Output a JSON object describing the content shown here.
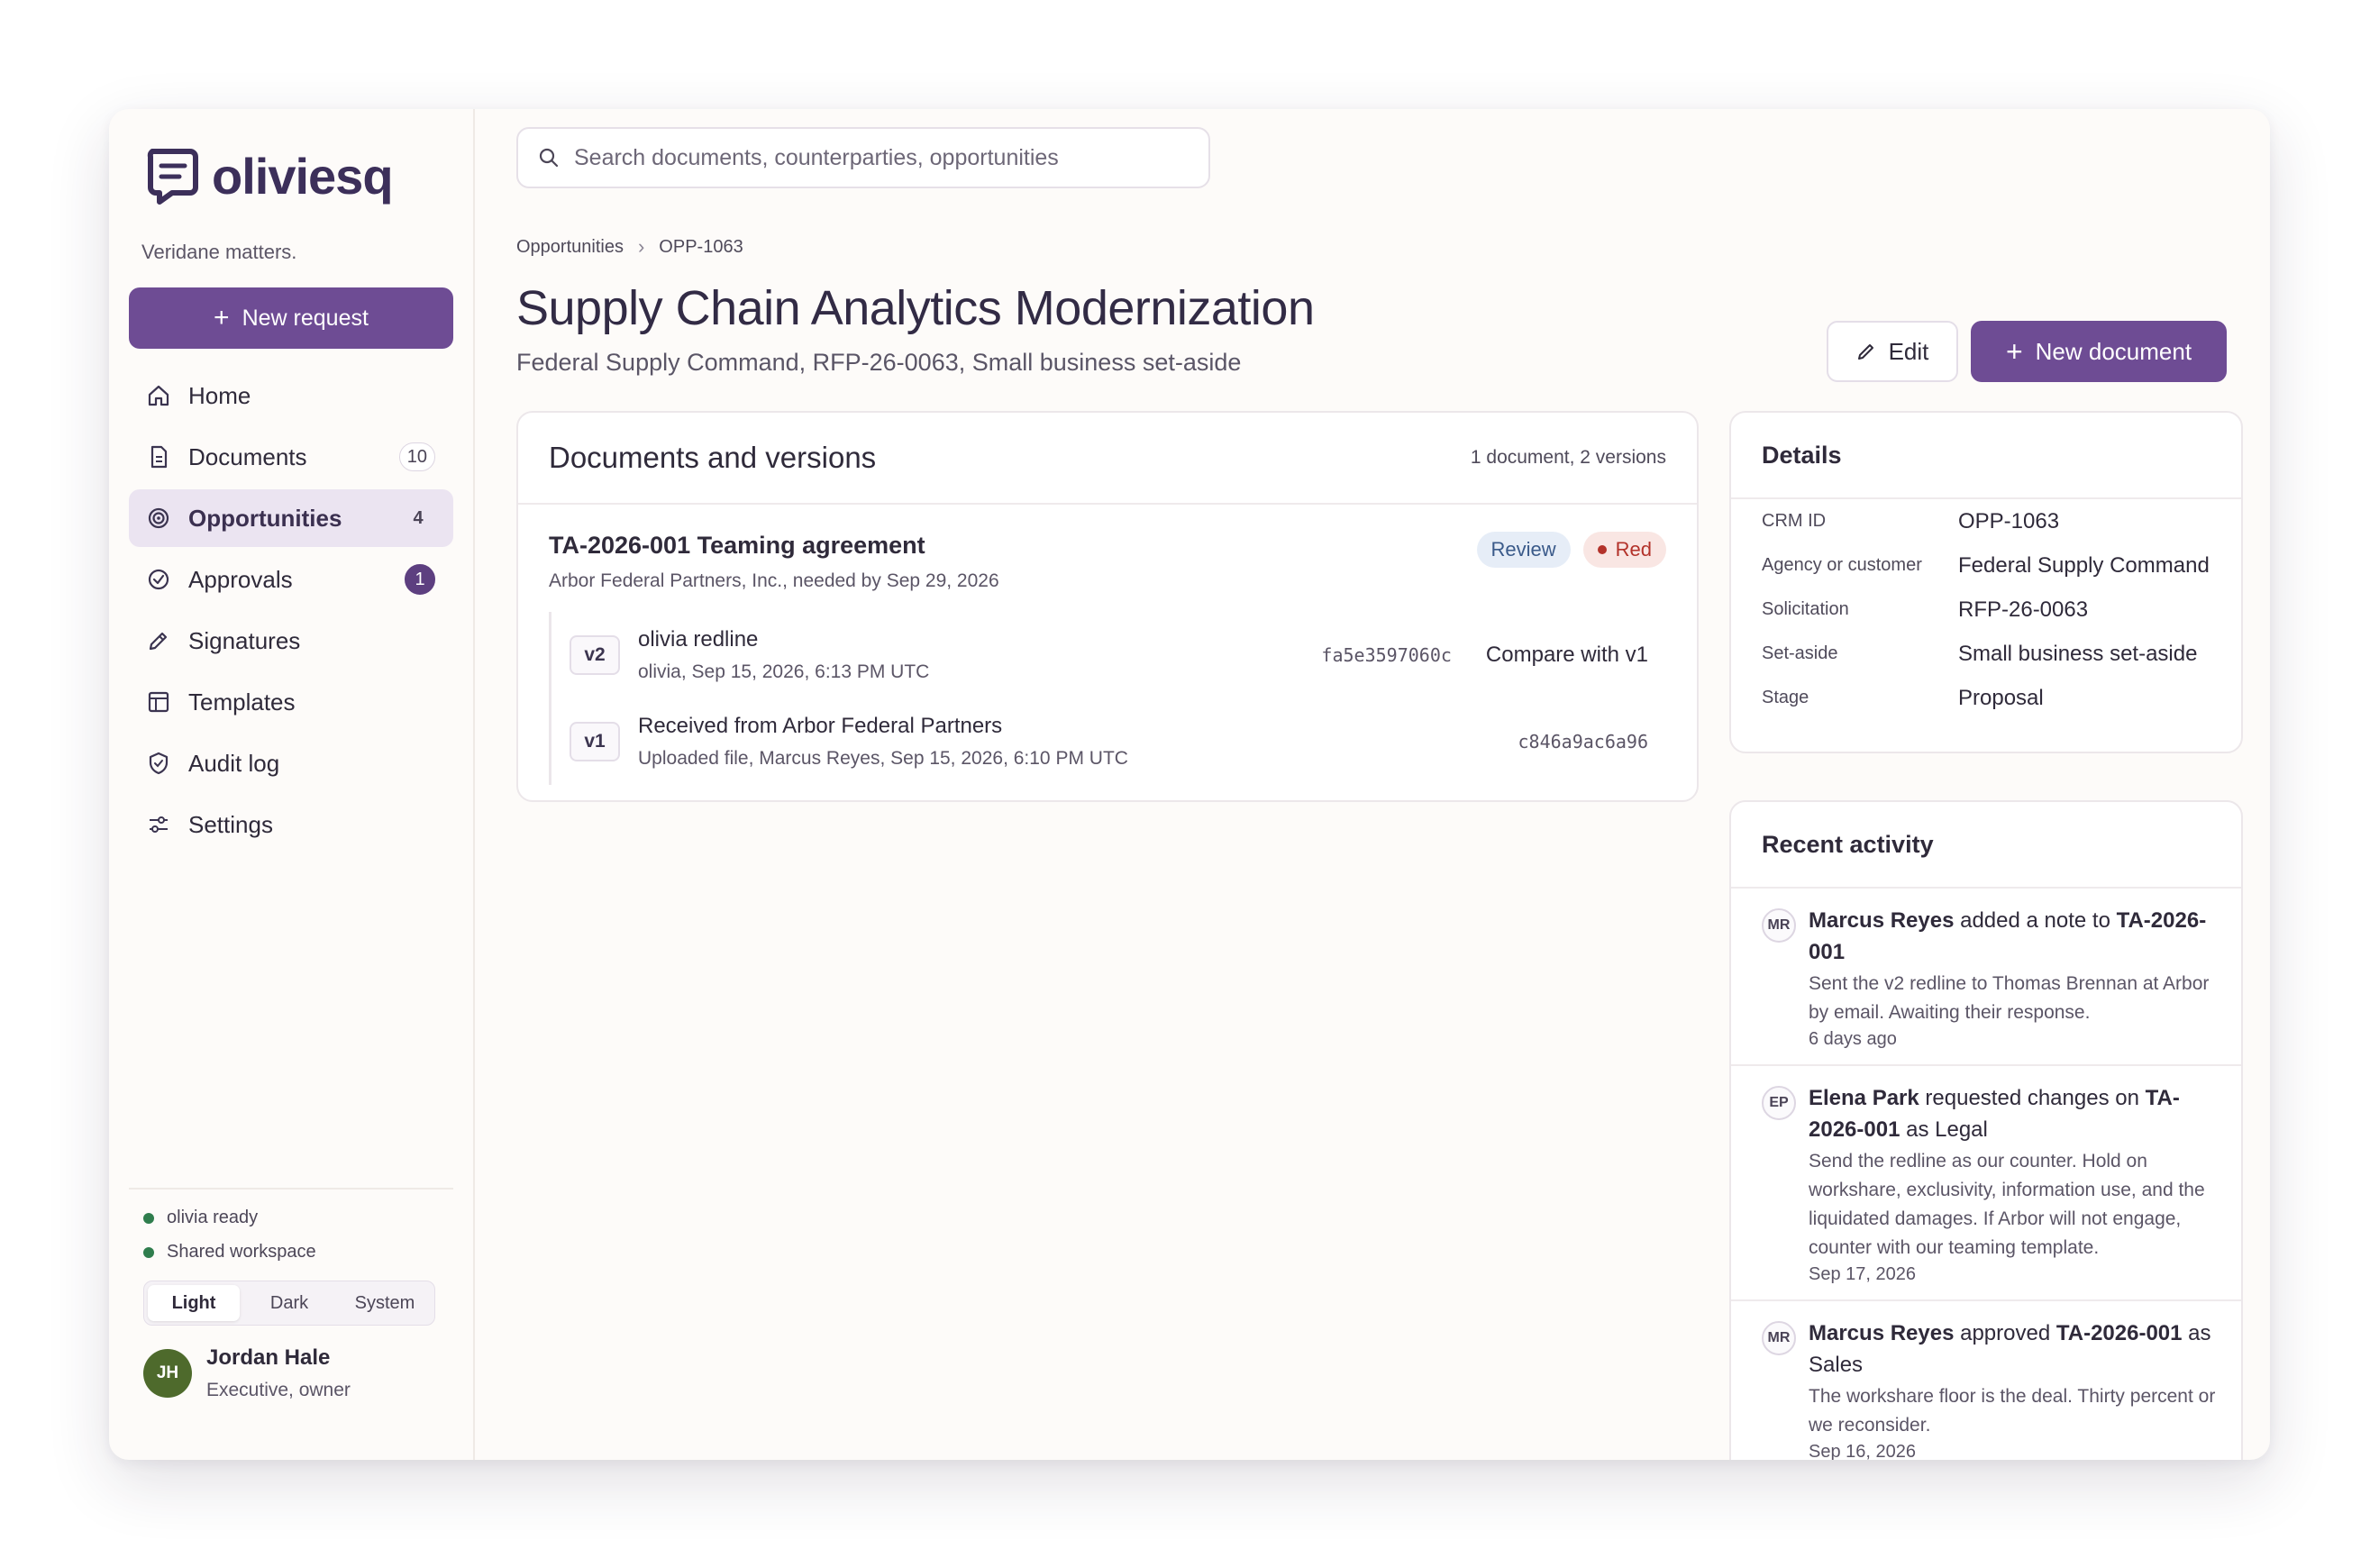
{
  "app": {
    "name": "oliviesq",
    "tagline": "Veridane matters.",
    "new_request_label": "New request"
  },
  "nav": [
    {
      "label": "Home",
      "icon": "home-icon",
      "count": null
    },
    {
      "label": "Documents",
      "icon": "document-icon",
      "count": "10"
    },
    {
      "label": "Opportunities",
      "icon": "target-icon",
      "count": "4",
      "active": true
    },
    {
      "label": "Approvals",
      "icon": "check-circle-icon",
      "count": "1"
    },
    {
      "label": "Signatures",
      "icon": "pen-icon",
      "count": null
    },
    {
      "label": "Templates",
      "icon": "template-icon",
      "count": null
    },
    {
      "label": "Audit log",
      "icon": "shield-icon",
      "count": null
    },
    {
      "label": "Settings",
      "icon": "sliders-icon",
      "count": null
    }
  ],
  "status": {
    "olivia": "olivia ready",
    "workspace": "Shared workspace"
  },
  "theme": {
    "options": [
      "Light",
      "Dark",
      "System"
    ],
    "selected": "Light"
  },
  "user": {
    "initials": "JH",
    "name": "Jordan Hale",
    "role": "Executive, owner"
  },
  "search": {
    "placeholder": "Search documents, counterparties, opportunities"
  },
  "breadcrumb": {
    "parent": "Opportunities",
    "current": "OPP-1063"
  },
  "page": {
    "title": "Supply Chain Analytics Modernization",
    "subtitle": "Federal Supply Command, RFP-26-0063, Small business set-aside",
    "edit_label": "Edit",
    "new_document_label": "New document"
  },
  "documents": {
    "title": "Documents and versions",
    "count_label": "1 document, 2 versions",
    "item": {
      "name": "TA-2026-001 Teaming agreement",
      "meta": "Arbor Federal Partners, Inc., needed by Sep 29, 2026",
      "status_badge": "Review",
      "risk_badge": "Red",
      "versions": [
        {
          "tag": "v2",
          "title": "olivia redline",
          "sub": "olivia, Sep 15, 2026, 6:13 PM UTC",
          "hash": "fa5e3597060c",
          "action": "Compare with v1"
        },
        {
          "tag": "v1",
          "title": "Received from Arbor Federal Partners",
          "sub": "Uploaded file, Marcus Reyes, Sep 15, 2026, 6:10 PM UTC",
          "hash": "c846a9ac6a96",
          "action": ""
        }
      ]
    }
  },
  "details": {
    "title": "Details",
    "rows": [
      {
        "label": "CRM ID",
        "value": "OPP-1063"
      },
      {
        "label": "Agency or customer",
        "value": "Federal Supply Command"
      },
      {
        "label": "Solicitation",
        "value": "RFP-26-0063"
      },
      {
        "label": "Set-aside",
        "value": "Small business set-aside"
      },
      {
        "label": "Stage",
        "value": "Proposal"
      }
    ]
  },
  "activity": {
    "title": "Recent activity",
    "items": [
      {
        "initials": "MR",
        "actor": "Marcus Reyes",
        "verb": " added a note to ",
        "target": "TA-2026-001",
        "suffix": "",
        "note": "Sent the v2 redline to Thomas Brennan at Arbor by email. Awaiting their response.",
        "time": "6 days ago"
      },
      {
        "initials": "EP",
        "actor": "Elena Park",
        "verb": " requested changes on ",
        "target": "TA-2026-001",
        "suffix": " as Legal",
        "note": "Send the redline as our counter. Hold on workshare, exclusivity, information use, and the liquidated damages. If Arbor will not engage, counter with our teaming template.",
        "time": "Sep 17, 2026"
      },
      {
        "initials": "MR",
        "actor": "Marcus Reyes",
        "verb": " approved ",
        "target": "TA-2026-001",
        "suffix": " as Sales",
        "note": "The workshare floor is the deal. Thirty percent or we reconsider.",
        "time": "Sep 16, 2026"
      }
    ]
  },
  "colors": {
    "accent": "#6e4c94",
    "status_green": "#2f7d4d",
    "risk_red": "#b3322a",
    "review_blue": "#3a5a8a"
  }
}
